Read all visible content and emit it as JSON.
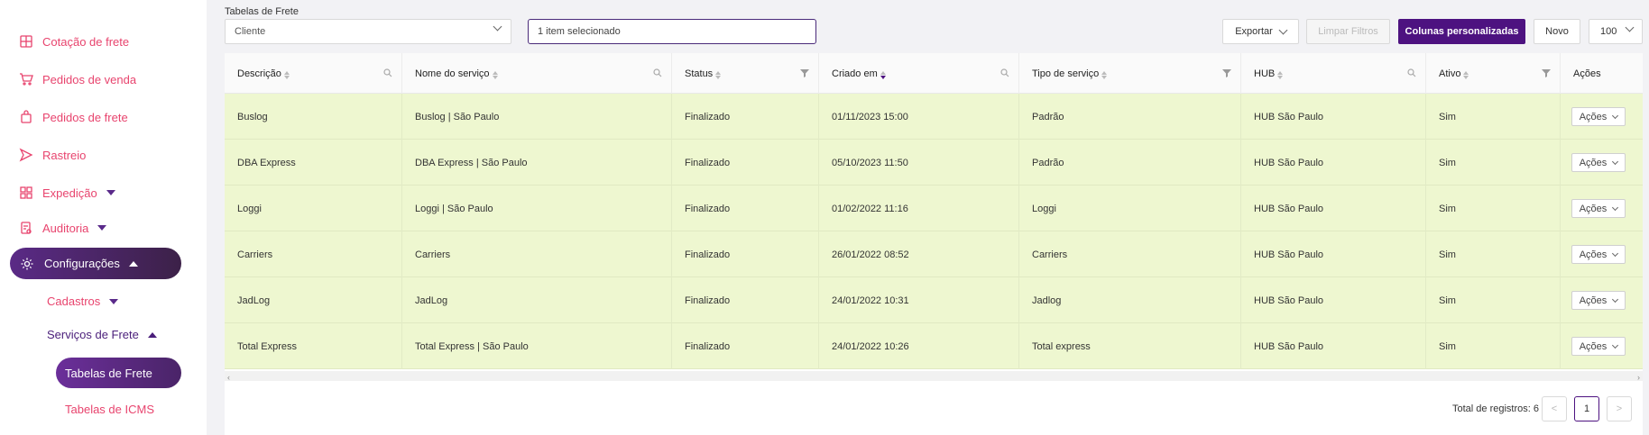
{
  "sidebar": {
    "items": [
      {
        "label": "Cotação de frete",
        "icon": "calculator-icon"
      },
      {
        "label": "Pedidos de venda",
        "icon": "cart-icon"
      },
      {
        "label": "Pedidos de frete",
        "icon": "bag-icon"
      },
      {
        "label": "Rastreio",
        "icon": "send-icon"
      },
      {
        "label": "Expedição",
        "icon": "grid-icon"
      },
      {
        "label": "Auditoria",
        "icon": "audit-icon"
      },
      {
        "label": "Configurações",
        "icon": "gear-icon"
      },
      {
        "label": "Cadastros"
      },
      {
        "label": "Serviços de Frete"
      },
      {
        "label": "Tabelas de Frete"
      },
      {
        "label": "Tabelas de ICMS"
      }
    ]
  },
  "filters": {
    "title": "Tabelas de Frete",
    "select_value": "Cliente",
    "multi_value": "1 item selecionado"
  },
  "toolbar": {
    "export_label": "Exportar",
    "clear_label": "Limpar Filtros",
    "columns_label": "Colunas personalizadas",
    "new_label": "Novo",
    "page_size": "100"
  },
  "table": {
    "columns": [
      "Descrição",
      "Nome do serviço",
      "Status",
      "Criado em",
      "Tipo de serviço",
      "HUB",
      "Ativo",
      "Ações"
    ],
    "action_label": "Ações",
    "rows": [
      [
        "Buslog",
        "Buslog | São Paulo",
        "Finalizado",
        "01/11/2023 15:00",
        "Padrão",
        "HUB São Paulo",
        "Sim"
      ],
      [
        "DBA Express",
        "DBA Express | São Paulo",
        "Finalizado",
        "05/10/2023 11:50",
        "Padrão",
        "HUB São Paulo",
        "Sim"
      ],
      [
        "Loggi",
        "Loggi | São Paulo",
        "Finalizado",
        "01/02/2022 11:16",
        "Loggi",
        "HUB São Paulo",
        "Sim"
      ],
      [
        "Carriers",
        "Carriers",
        "Finalizado",
        "26/01/2022 08:52",
        "Carriers",
        "HUB São Paulo",
        "Sim"
      ],
      [
        "JadLog",
        "JadLog",
        "Finalizado",
        "24/01/2022 10:31",
        "Jadlog",
        "HUB São Paulo",
        "Sim"
      ],
      [
        "Total Express",
        "Total Express | São Paulo",
        "Finalizado",
        "24/01/2022 10:26",
        "Total express",
        "HUB São Paulo",
        "Sim"
      ]
    ]
  },
  "pagination": {
    "total_text": "Total de registros: 6",
    "current_page": "1",
    "prev": "<",
    "next": ">"
  },
  "colors": {
    "accent": "#4d1280",
    "nav_text": "#e8446e",
    "row_bg": "#eef7d0"
  }
}
